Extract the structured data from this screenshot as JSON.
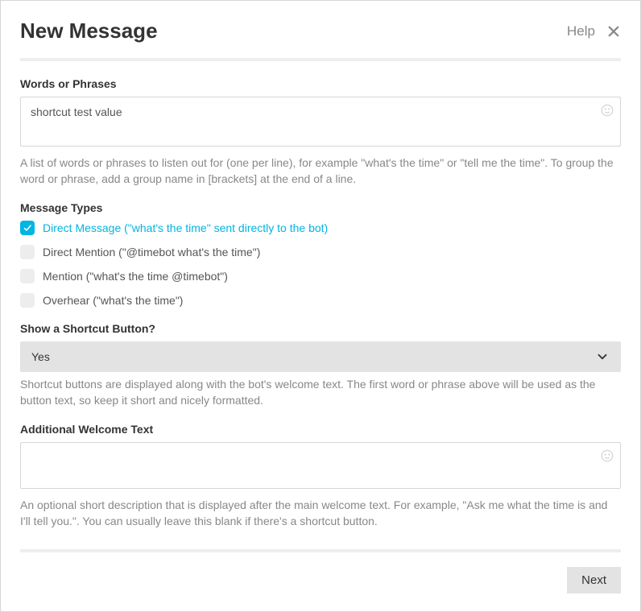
{
  "header": {
    "title": "New Message",
    "help_label": "Help"
  },
  "words": {
    "label": "Words or Phrases",
    "value": "shortcut test value",
    "helper": "A list of words or phrases to listen out for (one per line), for example \"what's the time\" or \"tell me the time\". To group the word or phrase, add a group name in [brackets] at the end of a line."
  },
  "message_types": {
    "label": "Message Types",
    "options": [
      {
        "label": "Direct Message (\"what's the time\" sent directly to the bot)",
        "checked": true
      },
      {
        "label": "Direct Mention (\"@timebot what's the time\")",
        "checked": false
      },
      {
        "label": "Mention (\"what's the time @timebot\")",
        "checked": false
      },
      {
        "label": "Overhear (\"what's the time\")",
        "checked": false
      }
    ]
  },
  "shortcut": {
    "label": "Show a Shortcut Button?",
    "selected": "Yes",
    "helper": "Shortcut buttons are displayed along with the bot's welcome text. The first word or phrase above will be used as the button text, so keep it short and nicely formatted."
  },
  "welcome": {
    "label": "Additional Welcome Text",
    "value": "",
    "helper": "An optional short description that is displayed after the main welcome text. For example, \"Ask me what the time is and I'll tell you.\". You can usually leave this blank if there's a shortcut button."
  },
  "footer": {
    "next_label": "Next"
  }
}
